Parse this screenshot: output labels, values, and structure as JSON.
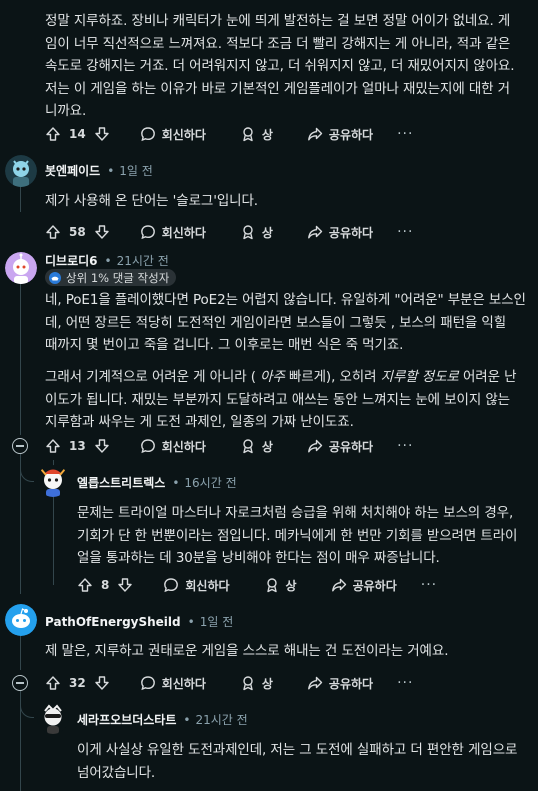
{
  "comments": [
    {
      "text": "정말 지루하죠. 장비나 캐릭터가 눈에 띄게 발전하는 걸 보면 정말 어이가 없네요. 게\n임이 너무 직선적으로 느껴져요. 적보다 조금 더 빨리 강해지는 게 아니라, 적과 같은\n속도로 강해지는 거죠. 더 어려워지지 않고, 더 쉬워지지 않고, 더 재밌어지지 않아요.\n저는 이 게임을 하는 이유가 바로 기본적인 게임플레이가 얼마나 재밌는지에 대한 거\n니까요.",
      "votes": "14"
    },
    {
      "author": "봇엔페이드",
      "time": "1일 전",
      "text": "제가 사용해 온 단어는 '슬로그'입니다.",
      "votes": "58"
    },
    {
      "author": "디브로디6",
      "time": "21시간 전",
      "flair": "상위 1% 댓글 작성자",
      "text1": "네, PoE1을 플레이했다면 PoE2는 어렵지 않습니다. 유일하게 \"어려운\" 부분은 보스인\n데, 어떤 장르든 적당히 도전적인 게임이라면 보스들이 그렇듯 , 보스의 패턴을 익힐\n때까지 몇 번이고 죽을 겁니다. 그 이후로는 매번 식은 죽 먹기죠.",
      "text2a": "그래서 기계적으로 어려운 게 아니라 ( ",
      "text2b": "아주",
      "text2c": " 빠르게), 오히려 ",
      "text2d": "지루할 정도로",
      "text2e": " 어려운 난\n이도가 됩니다. 재밌는 부분까지 도달하려고 애쓰는 동안 느껴지는 눈에 보이지 않는\n지루함과 싸우는 게 도전 과제인, 일종의 가짜 난이도죠.",
      "votes": "13"
    },
    {
      "author": "엘릅스트리트렉스",
      "time": "16시간 전",
      "text": "문제는 트라이얼 마스터나 자로크처럼 승급을 위해 처치해야 하는 보스의 경우,\n기회가 단 한 번뿐이라는 점입니다. 메카닉에게 한 번만 기회를 받으려면 트라이\n얼을 통과하는 데 30분을 낭비해야 한다는 점이 매우 짜증납니다.",
      "votes": "8"
    },
    {
      "author": "PathOfEnergySheild",
      "time": "1일 전",
      "text": "제 말은, 지루하고 권태로운 게임을 스스로 해내는 건 도전이라는 거예요.",
      "votes": "32"
    },
    {
      "author": "세라프오브더스타트",
      "time": "21시간 전",
      "text": "이게 사실상 유일한 도전과제인데, 저는 그 도전에 실패하고 더 편안한 게임으로\n넘어갔습니다."
    }
  ],
  "actions": {
    "reply": "회신하다",
    "award": "상",
    "share": "공유하다",
    "more": "···"
  },
  "separator": "•"
}
